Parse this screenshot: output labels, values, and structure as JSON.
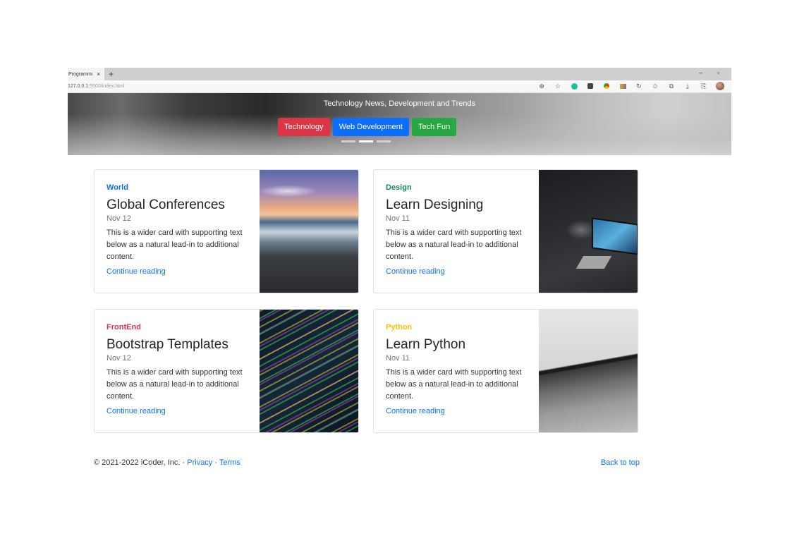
{
  "browser": {
    "tab_title": "Programmi",
    "tab_close": "×",
    "new_tab": "+",
    "minimize": "–",
    "restore": "▫",
    "address_host": "127.0.0.1:",
    "address_rest": "5500/index.html",
    "toolbar_icons": [
      "zoom-icon",
      "favorite-add-icon",
      "grammarly-icon",
      "extension-icon",
      "extension-icon-2",
      "extension-icon-3",
      "refresh-icon",
      "favorites-icon",
      "collections-icon",
      "downloads-icon",
      "share-icon",
      "profile-avatar-icon"
    ]
  },
  "hero": {
    "subtitle": "Technology News, Development and Trends",
    "buttons": [
      {
        "label": "Technology",
        "color": "#dc3545"
      },
      {
        "label": "Web Development",
        "color": "#0d6efd"
      },
      {
        "label": "Tech Fun",
        "color": "#28a745"
      }
    ],
    "active_indicator": 2
  },
  "cards": [
    {
      "category": "World",
      "category_color": "#0d6efd",
      "title": "Global Conferences",
      "date": "Nov 12",
      "text": "This is a wider card with supporting text below as a natural lead-in to additional content.",
      "link": "Continue reading"
    },
    {
      "category": "Design",
      "category_color": "#198754",
      "title": "Learn Designing",
      "date": "Nov 11",
      "text": "This is a wider card with supporting text below as a natural lead-in to additional content.",
      "link": "Continue reading"
    },
    {
      "category": "FrontEnd",
      "category_color": "#dc3545",
      "title": "Bootstrap Templates",
      "date": "Nov 12",
      "text": "This is a wider card with supporting text below as a natural lead-in to additional content.",
      "link": "Continue reading"
    },
    {
      "category": "Python",
      "category_color": "#ffc107",
      "title": "Learn Python",
      "date": "Nov 11",
      "text": "This is a wider card with supporting text below as a natural lead-in to additional content.",
      "link": "Continue reading"
    }
  ],
  "footer": {
    "copyright": "© 2021-2022 iCoder, Inc. ·",
    "privacy": "Privacy",
    "separator": "·",
    "terms": "Terms",
    "back_to_top": "Back to top"
  }
}
